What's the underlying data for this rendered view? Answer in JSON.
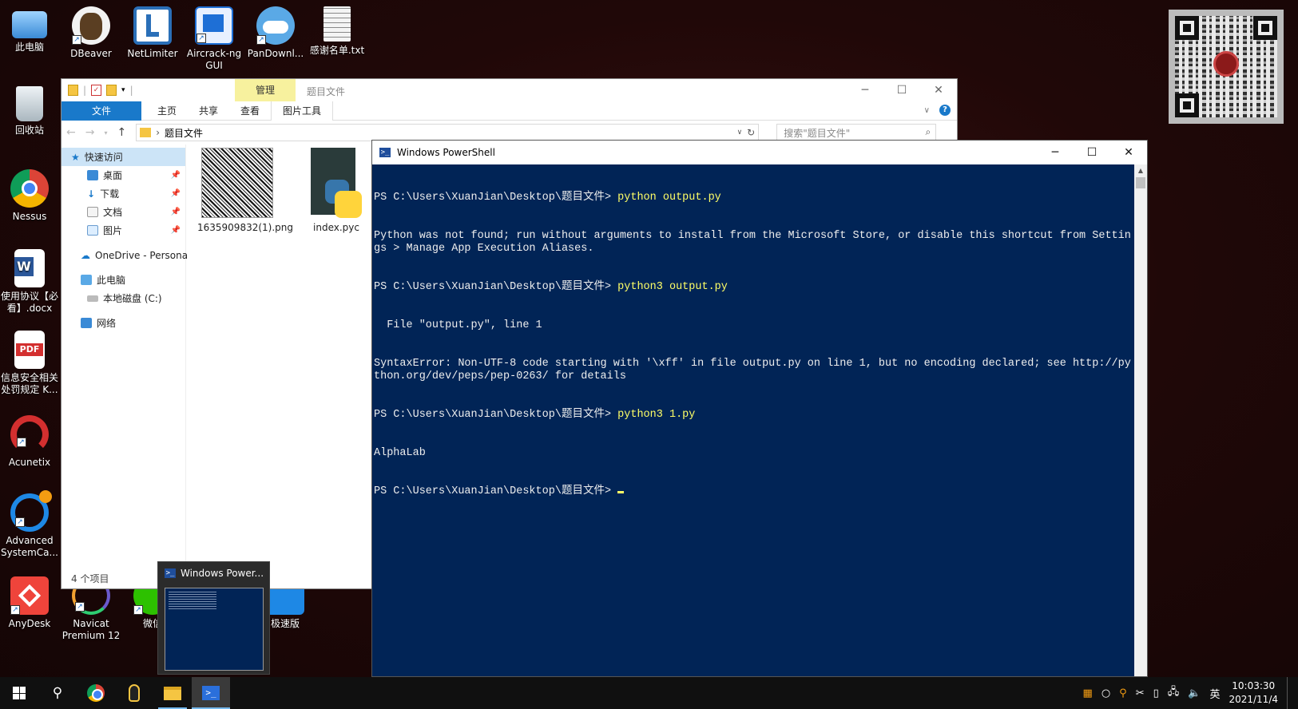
{
  "desktop": {
    "icons": [
      {
        "label": "此电脑",
        "icon": "this-pc-icon",
        "color": "#4aa3e8"
      },
      {
        "label": "DBeaver",
        "icon": "dbeaver-icon",
        "color": "#6b4a2b"
      },
      {
        "label": "NetLimiter",
        "icon": "netlimiter-icon",
        "color": "#2a6fb8"
      },
      {
        "label": "Aircrack-ng GUI",
        "icon": "aircrack-icon",
        "color": "#1e6fd6"
      },
      {
        "label": "PanDownl...",
        "icon": "pandownload-icon",
        "color": "#5aa9e6"
      },
      {
        "label": "感谢名单.txt",
        "icon": "text-file-icon",
        "color": "#e8e8e8"
      },
      {
        "label": "回收站",
        "icon": "recycle-bin-icon",
        "color": "#cfd8dc"
      },
      {
        "label": "Nessus",
        "icon": "chrome-icon",
        "color": "#db4437"
      },
      {
        "label": "使用协议【必看】.docx",
        "icon": "word-icon",
        "color": "#2b579a"
      },
      {
        "label": "信息安全相关处罚规定 K...",
        "icon": "pdf-icon",
        "color": "#d32f2f"
      },
      {
        "label": "Acunetix",
        "icon": "acunetix-icon",
        "color": "#d32f2f"
      },
      {
        "label": "Advanced SystemCa...",
        "icon": "advanced-systemcare-icon",
        "color": "#1e88e5"
      },
      {
        "label": "AnyDesk",
        "icon": "anydesk-icon",
        "color": "#ef443b"
      },
      {
        "label": "Navicat Premium 12",
        "icon": "navicat-icon",
        "color": "#f0a030"
      },
      {
        "label": "微信",
        "icon": "wechat-icon",
        "color": "#2dc100"
      },
      {
        "label": "极速版",
        "icon": "app-icon",
        "color": "#1e88e5"
      }
    ]
  },
  "explorer": {
    "folder_title": "题目文件",
    "manage_tab": "管理",
    "ribbon_tabs": [
      "文件",
      "主页",
      "共享",
      "查看",
      "图片工具"
    ],
    "address_path": "题目文件",
    "search_placeholder": "搜索\"题目文件\"",
    "nav": {
      "quick_access": "快速访问",
      "desktop": "桌面",
      "downloads": "下载",
      "documents": "文档",
      "pictures": "图片",
      "onedrive": "OneDrive - Persona",
      "this_pc": "此电脑",
      "local_disk": "本地磁盘 (C:)",
      "network": "网络"
    },
    "files": [
      {
        "name": "1635909832(1).png"
      },
      {
        "name": "index.pyc"
      }
    ],
    "status": "4 个项目"
  },
  "powershell": {
    "title": "Windows PowerShell",
    "lines": [
      {
        "prompt": "PS C:\\Users\\XuanJian\\Desktop\\题目文件> ",
        "cmd": "python output.py"
      },
      {
        "text": "Python was not found; run without arguments to install from the Microsoft Store, or disable this shortcut from Settings > Manage App Execution Aliases."
      },
      {
        "prompt": "PS C:\\Users\\XuanJian\\Desktop\\题目文件> ",
        "cmd": "python3 output.py"
      },
      {
        "text": "  File \"output.py\", line 1"
      },
      {
        "text": "SyntaxError: Non-UTF-8 code starting with '\\xff' in file output.py on line 1, but no encoding declared; see http://python.org/dev/peps/pep-0263/ for details"
      },
      {
        "prompt": "PS C:\\Users\\XuanJian\\Desktop\\题目文件> ",
        "cmd": "python3 1.py"
      },
      {
        "text": "AlphaLab"
      },
      {
        "prompt": "PS C:\\Users\\XuanJian\\Desktop\\题目文件> ",
        "cmd": ""
      }
    ]
  },
  "preview": {
    "title": "Windows Power..."
  },
  "taskbar": {
    "ime": "英",
    "time": "10:03:30",
    "date": "2021/11/4"
  }
}
